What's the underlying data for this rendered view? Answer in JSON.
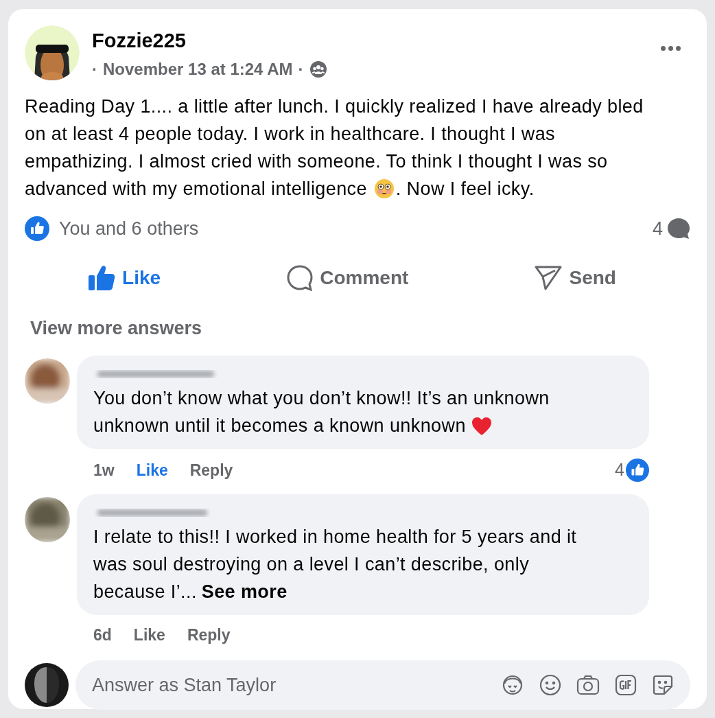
{
  "post": {
    "author": "Fozzie225",
    "meta_prefix": "·",
    "time": "November 13 at 1:24 AM",
    "meta_sep": "·",
    "body": [
      {
        "kind": "text",
        "text": "Reading Day 1.... a little after lunch. I quickly realized I have already bled on at least 4 people today. I work in healthcare. I thought I was empathizing. I almost cried with someone. To think I thought I was so advanced with my emotional intelligence "
      },
      {
        "kind": "flushed_emoji"
      },
      {
        "kind": "text",
        "text": ". Now I feel icky."
      }
    ],
    "reactions": "You and 6 others",
    "comment_count": "4",
    "actions": [
      {
        "kind": "like",
        "label": "Like",
        "selected": true
      },
      {
        "kind": "comment",
        "label": "Comment",
        "selected": false
      },
      {
        "kind": "send",
        "label": "Send",
        "selected": false
      }
    ]
  },
  "view_more": "View more answers",
  "comments": [
    {
      "segments": [
        {
          "kind": "text",
          "text": "You don’t know what you don’t know!! It’s an unknown unknown until it becomes a known unknown "
        },
        {
          "kind": "heart_emoji"
        }
      ],
      "time": "1w",
      "like": "Like",
      "liked": true,
      "reply": "Reply",
      "reaction_count": "4"
    },
    {
      "segments": [
        {
          "kind": "text",
          "text": "I relate to this!! I worked in home health for 5 years and it was soul destroying on a level I can’t describe, only because I’..."
        }
      ],
      "see_more": "See more",
      "time": "6d",
      "like": "Like",
      "liked": false,
      "reply": "Reply"
    }
  ],
  "composer": {
    "placeholder": "Answer as Stan Taylor"
  }
}
